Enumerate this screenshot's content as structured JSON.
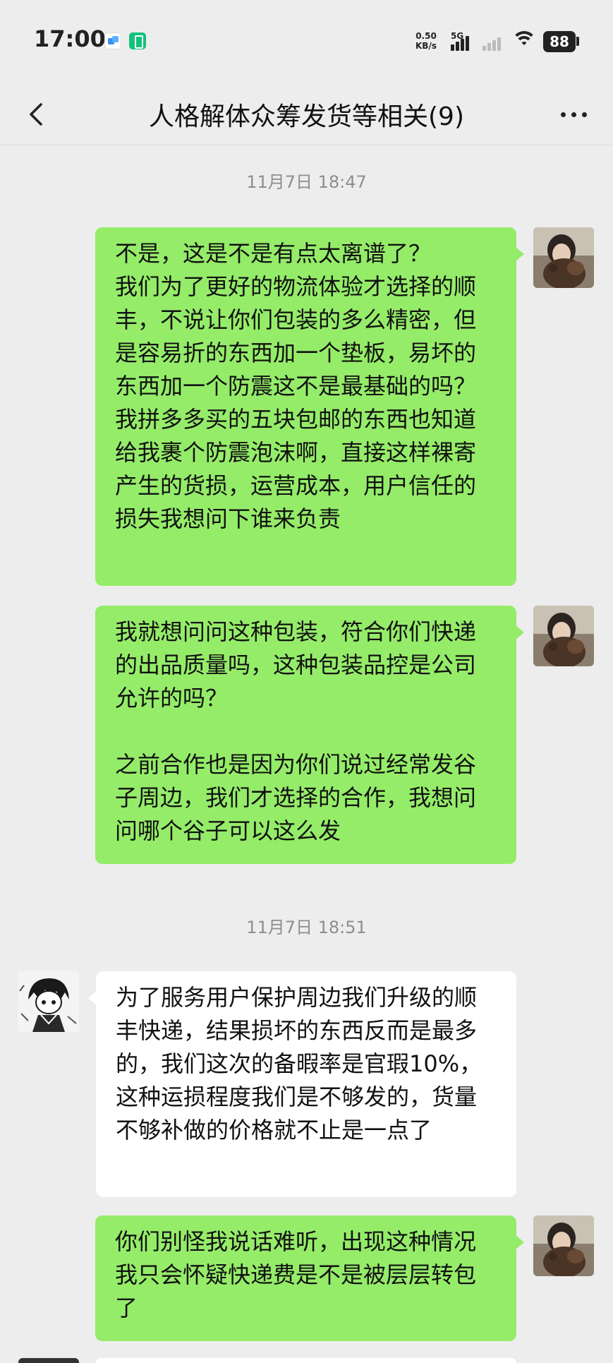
{
  "status_bar": {
    "time": "17:00",
    "net_speed_value": "0.50",
    "net_speed_unit": "KB/s",
    "network_type": "5G",
    "battery": "88"
  },
  "header": {
    "title": "人格解体众筹发货等相关(9)"
  },
  "messages": [
    {
      "type": "timestamp",
      "text": "11月7日 18:47"
    },
    {
      "type": "bubble",
      "side": "right",
      "text": "不是，这是不是有点太离谱了？\n我们为了更好的物流体验才选择的顺丰，不说让你们包装的多么精密，但是容易折的东西加一个垫板，易坏的东西加一个防震这不是最基础的吗？\n我拼多多买的五块包邮的东西也知道给我裹个防震泡沫啊，直接这样裸寄产生的货损，运营成本，用户信任的损失我想问下谁来负责"
    },
    {
      "type": "bubble",
      "side": "right",
      "text": "我就想问问这种包装，符合你们快递的出品质量吗，这种包装品控是公司允许的吗？\n\n之前合作也是因为你们说过经常发谷子周边，我们才选择的合作，我想问问哪个谷子可以这么发"
    },
    {
      "type": "timestamp",
      "text": "11月7日 18:51"
    },
    {
      "type": "bubble",
      "side": "left",
      "text": "为了服务用户保护周边我们升级的顺丰快递，结果损坏的东西反而是最多的，我们这次的备暇率是官瑕10%，这种运损程度我们是不够发的，货量不够补做的价格就不止是一点了"
    },
    {
      "type": "bubble",
      "side": "right",
      "text": "你们别怪我说话难听，出现这种情况我只会怀疑快递费是不是被层层转包了"
    }
  ],
  "colors": {
    "background": "#ededed",
    "bubble_out": "#95ec69",
    "bubble_in": "#ffffff",
    "timestamp": "#8e8e8e"
  },
  "icons": {
    "back": "chevron-left-icon",
    "more": "more-dots-icon",
    "wifi": "wifi-icon",
    "signal": "signal-bars-icon",
    "battery": "battery-icon"
  }
}
